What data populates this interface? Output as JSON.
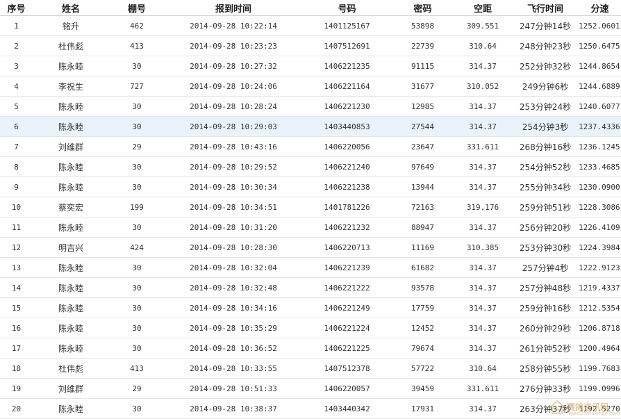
{
  "table": {
    "headers": {
      "rank": "序号",
      "name": "姓名",
      "loft": "棚号",
      "arrival": "报到时间",
      "ring": "号码",
      "code": "密码",
      "distance": "空距",
      "flight_time": "飞行时间",
      "speed": "分速"
    },
    "highlighted_row_rank": "6",
    "rows": [
      {
        "rank": "1",
        "name": "铭升",
        "loft": "462",
        "arrival": "2014-09-28  10:22:14",
        "ring": "1401125167",
        "code": "53898",
        "distance": "309.551",
        "flight_time": "247分钟14秒",
        "speed": "1252.0601"
      },
      {
        "rank": "2",
        "name": "杜伟彪",
        "loft": "413",
        "arrival": "2014-09-28  10:23:23",
        "ring": "1407512691",
        "code": "22739",
        "distance": "310.64",
        "flight_time": "248分钟23秒",
        "speed": "1250.6475"
      },
      {
        "rank": "3",
        "name": "陈永睦",
        "loft": "30",
        "arrival": "2014-09-28  10:27:32",
        "ring": "1406221235",
        "code": "91115",
        "distance": "314.37",
        "flight_time": "252分钟32秒",
        "speed": "1244.8654"
      },
      {
        "rank": "4",
        "name": "李祝生",
        "loft": "727",
        "arrival": "2014-09-28  10:24:06",
        "ring": "1406221164",
        "code": "31677",
        "distance": "310.052",
        "flight_time": "249分钟6秒",
        "speed": "1244.6889"
      },
      {
        "rank": "5",
        "name": "陈永睦",
        "loft": "30",
        "arrival": "2014-09-28  10:28:24",
        "ring": "1406221230",
        "code": "12985",
        "distance": "314.37",
        "flight_time": "253分钟24秒",
        "speed": "1240.6077"
      },
      {
        "rank": "6",
        "name": "陈永睦",
        "loft": "30",
        "arrival": "2014-09-28  10:29:03",
        "ring": "1403440853",
        "code": "27544",
        "distance": "314.37",
        "flight_time": "254分钟3秒",
        "speed": "1237.4336"
      },
      {
        "rank": "7",
        "name": "刘维群",
        "loft": "29",
        "arrival": "2014-09-28  10:43:16",
        "ring": "1406220056",
        "code": "23647",
        "distance": "331.611",
        "flight_time": "268分钟16秒",
        "speed": "1236.1245"
      },
      {
        "rank": "8",
        "name": "陈永睦",
        "loft": "30",
        "arrival": "2014-09-28  10:29:52",
        "ring": "1406221240",
        "code": "97649",
        "distance": "314.37",
        "flight_time": "254分钟52秒",
        "speed": "1233.4685"
      },
      {
        "rank": "9",
        "name": "陈永睦",
        "loft": "30",
        "arrival": "2014-09-28  10:30:34",
        "ring": "1406221238",
        "code": "13944",
        "distance": "314.37",
        "flight_time": "255分钟34秒",
        "speed": "1230.0900"
      },
      {
        "rank": "10",
        "name": "蔡奕宏",
        "loft": "199",
        "arrival": "2014-09-28  10:34:51",
        "ring": "1401781226",
        "code": "72163",
        "distance": "319.176",
        "flight_time": "259分钟51秒",
        "speed": "1228.3086"
      },
      {
        "rank": "11",
        "name": "陈永睦",
        "loft": "30",
        "arrival": "2014-09-28  10:31:20",
        "ring": "1406221232",
        "code": "88947",
        "distance": "314.37",
        "flight_time": "256分钟20秒",
        "speed": "1226.4109"
      },
      {
        "rank": "12",
        "name": "明吉兴",
        "loft": "424",
        "arrival": "2014-09-28  10:28:30",
        "ring": "1406220713",
        "code": "11169",
        "distance": "310.385",
        "flight_time": "253分钟30秒",
        "speed": "1224.3984"
      },
      {
        "rank": "13",
        "name": "陈永睦",
        "loft": "30",
        "arrival": "2014-09-28  10:32:04",
        "ring": "1406221239",
        "code": "61682",
        "distance": "314.37",
        "flight_time": "257分钟4秒",
        "speed": "1222.9123"
      },
      {
        "rank": "14",
        "name": "陈永睦",
        "loft": "30",
        "arrival": "2014-09-28  10:32:48",
        "ring": "1406221222",
        "code": "93578",
        "distance": "314.37",
        "flight_time": "257分钟48秒",
        "speed": "1219.4337"
      },
      {
        "rank": "15",
        "name": "陈永睦",
        "loft": "30",
        "arrival": "2014-09-28  10:34:16",
        "ring": "1406221249",
        "code": "17759",
        "distance": "314.37",
        "flight_time": "259分钟16秒",
        "speed": "1212.5354"
      },
      {
        "rank": "16",
        "name": "陈永睦",
        "loft": "30",
        "arrival": "2014-09-28  10:35:29",
        "ring": "1406221224",
        "code": "12452",
        "distance": "314.37",
        "flight_time": "260分钟29秒",
        "speed": "1206.8718"
      },
      {
        "rank": "17",
        "name": "陈永睦",
        "loft": "30",
        "arrival": "2014-09-28  10:36:52",
        "ring": "1406221225",
        "code": "79674",
        "distance": "314.37",
        "flight_time": "261分钟52秒",
        "speed": "1200.4964"
      },
      {
        "rank": "18",
        "name": "杜伟彪",
        "loft": "413",
        "arrival": "2014-09-28  10:33:55",
        "ring": "1407512378",
        "code": "57722",
        "distance": "310.64",
        "flight_time": "258分钟55秒",
        "speed": "1199.7683"
      },
      {
        "rank": "19",
        "name": "刘维群",
        "loft": "29",
        "arrival": "2014-09-28  10:51:33",
        "ring": "1406220057",
        "code": "39459",
        "distance": "331.611",
        "flight_time": "276分钟33秒",
        "speed": "1199.0996"
      },
      {
        "rank": "20",
        "name": "陈永睦",
        "loft": "30",
        "arrival": "2014-09-28  10:38:37",
        "ring": "1403440342",
        "code": "17931",
        "distance": "314.37",
        "flight_time": "263分钟37秒",
        "speed": "1192.5270"
      }
    ]
  },
  "watermark": {
    "text": "赛鸽资讯网",
    "subtext": "www.chinaxinge.com",
    "color": "#c89a55"
  }
}
